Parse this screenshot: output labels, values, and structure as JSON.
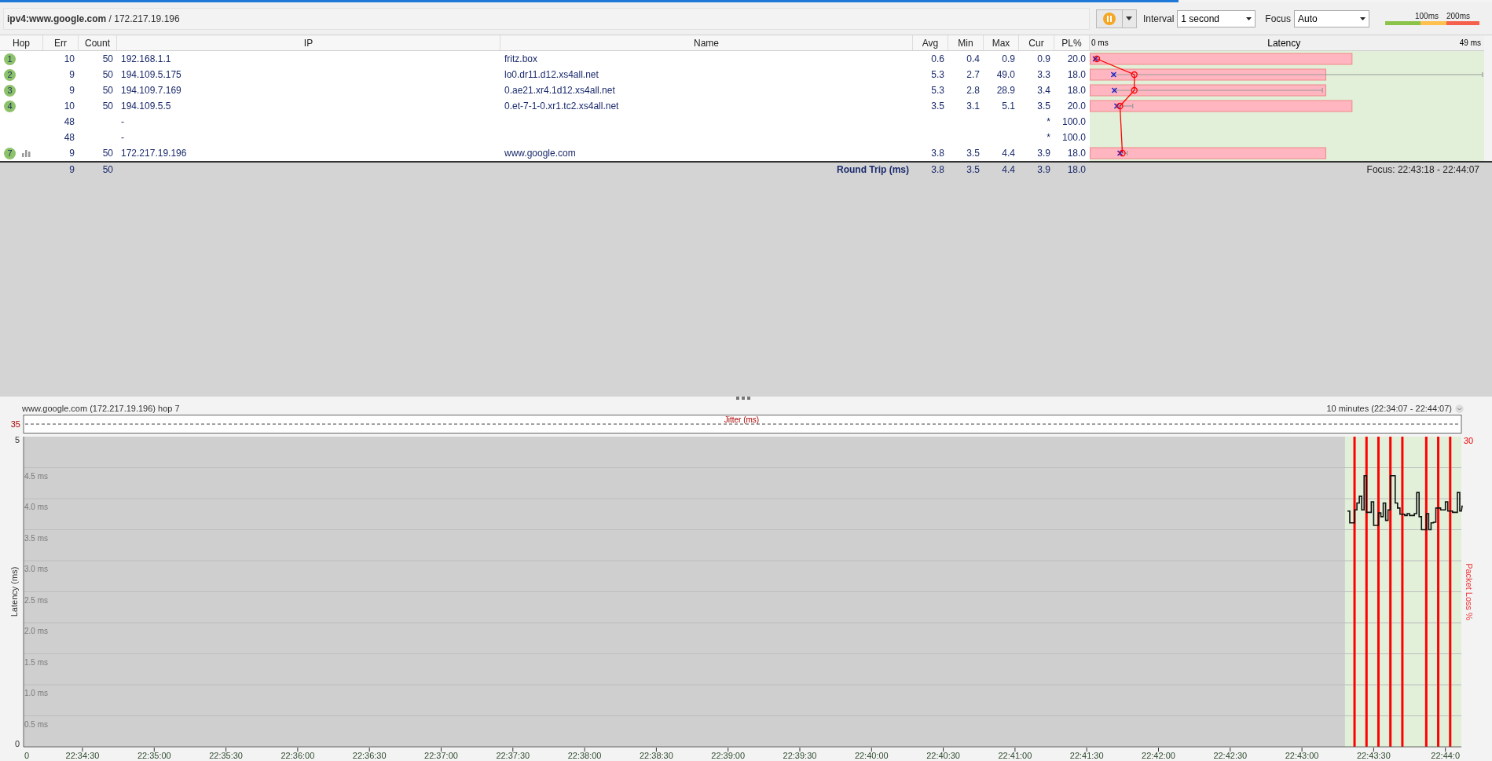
{
  "toolbar": {
    "target": "**ipv4:www.google.com** / 172.217.19.196",
    "paused": true,
    "interval_label": "Interval",
    "interval_value": "1 second",
    "focus_label": "Focus",
    "focus_value": "Auto",
    "legend": [
      "100ms",
      "200ms"
    ]
  },
  "table": {
    "columns": [
      "Hop",
      "Err",
      "Count",
      "IP",
      "Name",
      "Avg",
      "Min",
      "Max",
      "Cur",
      "PL%"
    ],
    "rows": [
      {
        "hop": "1",
        "has_graph": false,
        "err": "10",
        "count": "50",
        "ip": "192.168.1.1",
        "name": "fritz.box",
        "avg": "0.6",
        "min": "0.4",
        "max": "0.9",
        "cur": "0.9",
        "pl": "20.0"
      },
      {
        "hop": "2",
        "has_graph": false,
        "err": "9",
        "count": "50",
        "ip": "194.109.5.175",
        "name": "lo0.dr11.d12.xs4all.net",
        "avg": "5.3",
        "min": "2.7",
        "max": "49.0",
        "cur": "3.3",
        "pl": "18.0"
      },
      {
        "hop": "3",
        "has_graph": false,
        "err": "9",
        "count": "50",
        "ip": "194.109.7.169",
        "name": "0.ae21.xr4.1d12.xs4all.net",
        "avg": "5.3",
        "min": "2.8",
        "max": "28.9",
        "cur": "3.4",
        "pl": "18.0"
      },
      {
        "hop": "4",
        "has_graph": false,
        "err": "10",
        "count": "50",
        "ip": "194.109.5.5",
        "name": "0.et-7-1-0.xr1.tc2.xs4all.net",
        "avg": "3.5",
        "min": "3.1",
        "max": "5.1",
        "cur": "3.5",
        "pl": "20.0"
      },
      {
        "has_graph": false,
        "err": "48",
        "ip": "-",
        "cur": "*",
        "pl": "100.0"
      },
      {
        "has_graph": false,
        "err": "48",
        "ip": "-",
        "cur": "*",
        "pl": "100.0"
      },
      {
        "hop": "7",
        "has_graph": true,
        "err": "9",
        "count": "50",
        "ip": "172.217.19.196",
        "name": "www.google.com",
        "avg": "3.8",
        "min": "3.5",
        "max": "4.4",
        "cur": "3.9",
        "pl": "18.0"
      }
    ],
    "summary": {
      "err": "9",
      "count": "50",
      "label": "Round Trip (ms)",
      "avg": "3.8",
      "min": "3.5",
      "max": "4.4",
      "cur": "3.9",
      "pl": "18.0",
      "focus": "Focus: 22:43:18 - 22:44:07"
    },
    "latency_header": {
      "start": "0 ms",
      "title": "Latency",
      "end": "49 ms"
    }
  },
  "graph": {
    "title": "www.google.com (172.217.19.196) hop 7",
    "range": "10 minutes (22:34:07 - 22:44:07)",
    "jitter": {
      "label": "Jitter (ms)",
      "tick": "35"
    },
    "loss_axis": {
      "label": "Packet Loss %",
      "tick": "30"
    },
    "x_origin_label": "0",
    "y_end_labels": [
      "5",
      "0"
    ],
    "chart_data": {
      "type": "line",
      "ylabel": "Latency (ms)",
      "xlim": [
        81247,
        81847
      ],
      "ylim": [
        0,
        5
      ],
      "xticks": [
        {
          "value": 81270,
          "label": "22:34:30"
        },
        {
          "value": 81300,
          "label": "22:35:00"
        },
        {
          "value": 81330,
          "label": "22:35:30"
        },
        {
          "value": 81360,
          "label": "22:36:00"
        },
        {
          "value": 81390,
          "label": "22:36:30"
        },
        {
          "value": 81420,
          "label": "22:37:00"
        },
        {
          "value": 81450,
          "label": "22:37:30"
        },
        {
          "value": 81480,
          "label": "22:38:00"
        },
        {
          "value": 81510,
          "label": "22:38:30"
        },
        {
          "value": 81540,
          "label": "22:39:00"
        },
        {
          "value": 81570,
          "label": "22:39:30"
        },
        {
          "value": 81600,
          "label": "22:40:00"
        },
        {
          "value": 81630,
          "label": "22:40:30"
        },
        {
          "value": 81660,
          "label": "22:41:00"
        },
        {
          "value": 81690,
          "label": "22:41:30"
        },
        {
          "value": 81720,
          "label": "22:42:00"
        },
        {
          "value": 81750,
          "label": "22:42:30"
        },
        {
          "value": 81780,
          "label": "22:43:00"
        },
        {
          "value": 81810,
          "label": "22:43:30"
        },
        {
          "value": 81840,
          "label": "22:44:0"
        }
      ],
      "yticks": [
        {
          "value": 0.5,
          "label": "0.5 ms"
        },
        {
          "value": 1,
          "label": "1.0 ms"
        },
        {
          "value": 1.5,
          "label": "1.5 ms"
        },
        {
          "value": 2,
          "label": "2.0 ms"
        },
        {
          "value": 2.5,
          "label": "2.5 ms"
        },
        {
          "value": 3,
          "label": "3.0 ms"
        },
        {
          "value": 3.5,
          "label": "3.5 ms"
        },
        {
          "value": 4,
          "label": "4.0 ms"
        },
        {
          "value": 4.5,
          "label": "4.5 ms"
        }
      ],
      "x": [
        81799,
        81800,
        81801,
        81802,
        81803,
        81804,
        81805,
        81806,
        81807,
        81808,
        81809,
        81810,
        81811,
        81812,
        81813,
        81814,
        81815,
        81816,
        81817,
        81818,
        81819,
        81820,
        81821,
        81822,
        81823,
        81824,
        81825,
        81826,
        81827,
        81828,
        81829,
        81830,
        81831,
        81832,
        81833,
        81834,
        81835,
        81836,
        81837,
        81838,
        81839,
        81840,
        81841,
        81842,
        81843,
        81844,
        81845,
        81846,
        81847
      ],
      "series": [
        {
          "color": "#111111",
          "values": [
            3.8,
            3.61,
            3.61,
            3.82,
            3.93,
            4.04,
            3.82,
            4.37,
            3.78,
            3.78,
            3.95,
            3.57,
            3.57,
            3.77,
            3.71,
            3.93,
            3.65,
            3.82,
            4.37,
            4.37,
            3.93,
            3.85,
            3.75,
            3.75,
            3.73,
            3.76,
            3.73,
            3.73,
            3.76,
            4.1,
            3.71,
            3.5,
            3.5,
            3.76,
            3.5,
            3.61,
            3.62,
            3.85,
            3.85,
            3.82,
            3.82,
            3.95,
            3.8,
            3.8,
            3.78,
            3.78,
            4.1,
            3.8,
            3.88
          ]
        }
      ],
      "grid": true,
      "bands": [
        {
          "axis": "x",
          "from": 81798,
          "to": 81847,
          "color": "#e2f0d9"
        }
      ],
      "ref_lines": [
        {
          "axis": "x",
          "value": 81802,
          "color": "#ff0000"
        },
        {
          "axis": "x",
          "value": 81807,
          "color": "#ff0000"
        },
        {
          "axis": "x",
          "value": 81812,
          "color": "#ff0000"
        },
        {
          "axis": "x",
          "value": 81817,
          "color": "#ff0000"
        },
        {
          "axis": "x",
          "value": 81822,
          "color": "#ff0000"
        },
        {
          "axis": "x",
          "value": 81832,
          "color": "#ff0000"
        },
        {
          "axis": "x",
          "value": 81837,
          "color": "#ff0000"
        },
        {
          "axis": "x",
          "value": 81842,
          "color": "#ff0000"
        }
      ]
    }
  }
}
